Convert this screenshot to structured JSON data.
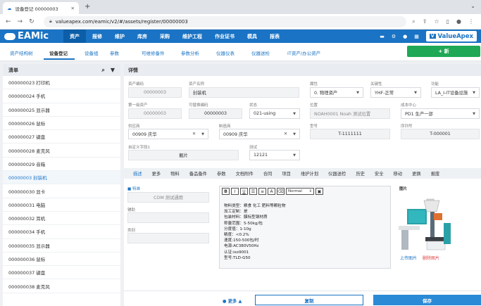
{
  "browser": {
    "tab_title": "设备登记 00000003",
    "url": "valueapex.com/eamic/v2/#/assets/register/00000003"
  },
  "app": {
    "logo": "EAMic",
    "brand": "ValueApex",
    "menu": [
      "资产",
      "报修",
      "维护",
      "库房",
      "采购",
      "维护工程",
      "作业证书",
      "模具",
      "报表"
    ],
    "active_menu": "资产"
  },
  "subnav": {
    "items": [
      "资产结构树",
      "设备登记",
      "设备组",
      "参数",
      "可维修备件",
      "参数分析",
      "仪器仪表",
      "仪器送检",
      "IT资产/办公资产"
    ],
    "active": "设备登记",
    "new_button": "+ 新"
  },
  "list": {
    "title": "清单",
    "items": [
      "000000023 打印机",
      "000000024 手机",
      "000000025 显示器",
      "000000026 鼠标",
      "000000027 键盘",
      "000000028 麦克风",
      "000000029 音箱",
      "00000003 封装机",
      "000000030 显卡",
      "000000031 电脑",
      "000000032 耳机",
      "000000034 手机",
      "000000035 显示器",
      "000000036 鼠标",
      "000000037 键盘",
      "000000038 麦克风"
    ],
    "selected_index": 7
  },
  "detail": {
    "title": "详情",
    "fields": {
      "asset_code": {
        "label": "资产编码",
        "value": "00000003"
      },
      "asset_name": {
        "label": "资产名称",
        "value": "封装机"
      },
      "attribute": {
        "label": "属性",
        "value": "0. 物理资产"
      },
      "status_label": {
        "label": "关键性",
        "value": "YHF-正常"
      },
      "function": {
        "label": "功能",
        "value": "LA_I-IT设备设施"
      },
      "parent": {
        "label": "第一级资产",
        "value": "00000003"
      },
      "repairable": {
        "label": "可替换编码",
        "value": "00000003"
      },
      "state": {
        "label": "状态",
        "value": "021-using"
      },
      "location": {
        "label": "位置",
        "value": "NOAH0001 Noah 测试位置"
      },
      "cost_center": {
        "label": "成本中心",
        "value": "PD1 生产一部"
      },
      "supplier": {
        "label": "供应商",
        "value": "00909 庆华"
      },
      "manufacturer": {
        "label": "制造商",
        "value": "00909 庆华"
      },
      "model": {
        "label": "型号",
        "value": "T-1111111"
      },
      "serial": {
        "label": "序列号",
        "value": "T-000001"
      },
      "custom1": {
        "label": "自定义字段1",
        "value": "靓片"
      },
      "test": {
        "label": "测试",
        "value": "12121"
      }
    },
    "tabs": [
      "描述",
      "更多",
      "物料",
      "备品备件",
      "参数",
      "文档附件",
      "合同",
      "项目",
      "维护计划",
      "仪器送检",
      "历史",
      "安全",
      "移动",
      "更换",
      "报废"
    ],
    "active_tab": "描述",
    "desc": {
      "checkbox_label": "特准",
      "field1_value": "COM 测试通用",
      "field2_label": "辅助",
      "field3_label": "类别"
    },
    "editor": {
      "format": "Normal",
      "lines": [
        "物料类型：粮食 化工 肥料等颗粒物",
        "加工定制：是",
        "包装材料：膜标型钢材质",
        "称量范围：5-50kg/包",
        "分度值：1-10g",
        "精度：<0.2%",
        "速度:150-500包/时",
        "电源:AC380V50Hz",
        "认证:iso9001",
        "型号:TLD-G50"
      ]
    },
    "image": {
      "label": "图片",
      "upload": "上传图片",
      "delete": "删除图片"
    },
    "footer": {
      "more": "更多",
      "copy": "复制",
      "save": "保存"
    }
  },
  "colors": {
    "primary": "#1a73c4",
    "green": "#1fa855",
    "delete": "#e04545"
  }
}
